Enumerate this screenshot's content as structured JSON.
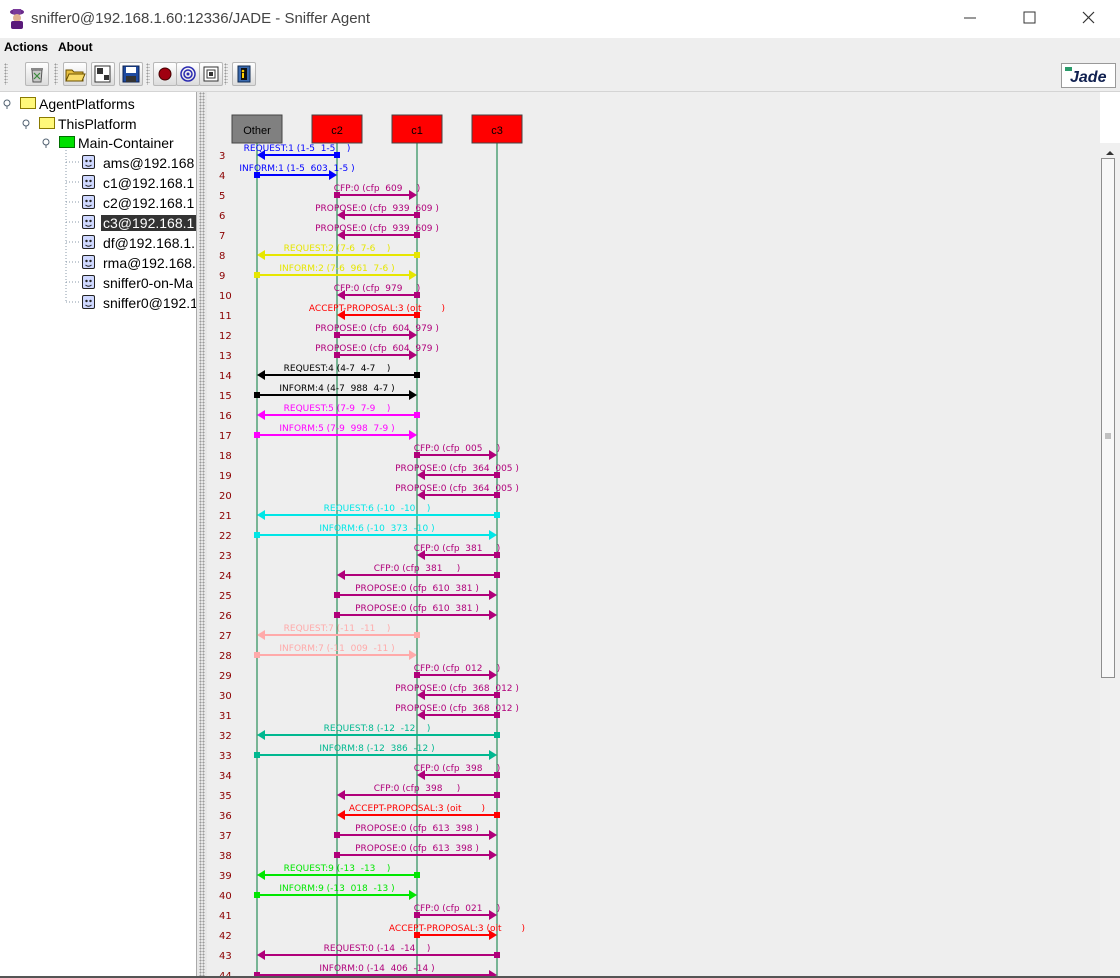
{
  "window": {
    "title": "sniffer0@192.168.1.60:12336/JADE - Sniffer Agent"
  },
  "menu": {
    "actions": "Actions",
    "about": "About"
  },
  "toolbar": {
    "buttons": [
      "clear-canvas-icon",
      "open-icon",
      "save-file-icon",
      "save-icon",
      "record-icon",
      "snif-icon",
      "filter-icon",
      "exit-icon"
    ]
  },
  "logo": {
    "text": "Jade"
  },
  "tree": {
    "root": "AgentPlatforms",
    "platform": "ThisPlatform",
    "container": "Main-Container",
    "agents": [
      {
        "label": "ams@192.168",
        "selected": false
      },
      {
        "label": "c1@192.168.1",
        "selected": false
      },
      {
        "label": "c2@192.168.1",
        "selected": false
      },
      {
        "label": "c3@192.168.1",
        "selected": true
      },
      {
        "label": "df@192.168.1.",
        "selected": false
      },
      {
        "label": "rma@192.168.",
        "selected": false
      },
      {
        "label": "sniffer0-on-Ma",
        "selected": false
      },
      {
        "label": "sniffer0@192.1",
        "selected": false
      }
    ]
  },
  "sniffer": {
    "agents": [
      {
        "name": "Other",
        "color": "#808080"
      },
      {
        "name": "c2",
        "color": "#ff0000"
      },
      {
        "name": "c1",
        "color": "#ff0000"
      },
      {
        "name": "c3",
        "color": "#ff0000"
      }
    ],
    "messages": [
      {
        "n": "3",
        "label": "REQUEST:1 (1-5  1-5    )",
        "from": "c2",
        "to": "Other",
        "color": "#0000ff"
      },
      {
        "n": "4",
        "label": "INFORM:1 (1-5  603  1-5 )",
        "from": "Other",
        "to": "c2",
        "color": "#0000ff"
      },
      {
        "n": "5",
        "label": "CFP:0 (cfp  609     )",
        "from": "c2",
        "to": "c1",
        "color": "#b0007a"
      },
      {
        "n": "6",
        "label": "PROPOSE:0 (cfp  939  609 )",
        "from": "c1",
        "to": "c2",
        "color": "#b0007a"
      },
      {
        "n": "7",
        "label": "PROPOSE:0 (cfp  939  609 )",
        "from": "c1",
        "to": "c2",
        "color": "#b0007a"
      },
      {
        "n": "8",
        "label": "REQUEST:2 (7-6  7-6    )",
        "from": "c1",
        "to": "Other",
        "color": "#e6e600"
      },
      {
        "n": "9",
        "label": "INFORM:2 (7-6  961  7-6 )",
        "from": "Other",
        "to": "c1",
        "color": "#e6e600"
      },
      {
        "n": "10",
        "label": "CFP:0 (cfp  979     )",
        "from": "c1",
        "to": "c2",
        "color": "#b0007a"
      },
      {
        "n": "11",
        "label": "ACCEPT-PROPOSAL:3 (oit       )",
        "from": "c1",
        "to": "c2",
        "color": "#ff0000"
      },
      {
        "n": "12",
        "label": "PROPOSE:0 (cfp  604  979 )",
        "from": "c2",
        "to": "c1",
        "color": "#b0007a"
      },
      {
        "n": "13",
        "label": "PROPOSE:0 (cfp  604  979 )",
        "from": "c2",
        "to": "c1",
        "color": "#b0007a"
      },
      {
        "n": "14",
        "label": "REQUEST:4 (4-7  4-7    )",
        "from": "c1",
        "to": "Other",
        "color": "#000000"
      },
      {
        "n": "15",
        "label": "INFORM:4 (4-7  988  4-7 )",
        "from": "Other",
        "to": "c1",
        "color": "#000000"
      },
      {
        "n": "16",
        "label": "REQUEST:5 (7-9  7-9    )",
        "from": "c1",
        "to": "Other",
        "color": "#ff00ff"
      },
      {
        "n": "17",
        "label": "INFORM:5 (7-9  998  7-9 )",
        "from": "Other",
        "to": "c1",
        "color": "#ff00ff"
      },
      {
        "n": "18",
        "label": "CFP:0 (cfp  005     )",
        "from": "c1",
        "to": "c3",
        "color": "#b0007a"
      },
      {
        "n": "19",
        "label": "PROPOSE:0 (cfp  364  005 )",
        "from": "c3",
        "to": "c1",
        "color": "#b0007a"
      },
      {
        "n": "20",
        "label": "PROPOSE:0 (cfp  364  005 )",
        "from": "c3",
        "to": "c1",
        "color": "#b0007a"
      },
      {
        "n": "21",
        "label": "REQUEST:6 (-10  -10    )",
        "from": "c3",
        "to": "Other",
        "color": "#00e6e6"
      },
      {
        "n": "22",
        "label": "INFORM:6 (-10  373  -10 )",
        "from": "Other",
        "to": "c3",
        "color": "#00e6e6"
      },
      {
        "n": "23",
        "label": "CFP:0 (cfp  381     )",
        "from": "c3",
        "to": "c1",
        "color": "#b0007a"
      },
      {
        "n": "24",
        "label": "CFP:0 (cfp  381     )",
        "from": "c3",
        "to": "c2",
        "color": "#b0007a"
      },
      {
        "n": "25",
        "label": "PROPOSE:0 (cfp  610  381 )",
        "from": "c2",
        "to": "c3",
        "color": "#b0007a"
      },
      {
        "n": "26",
        "label": "PROPOSE:0 (cfp  610  381 )",
        "from": "c2",
        "to": "c3",
        "color": "#b0007a"
      },
      {
        "n": "27",
        "label": "REQUEST:7 (-11  -11    )",
        "from": "c1",
        "to": "Other",
        "color": "#ffaaaa"
      },
      {
        "n": "28",
        "label": "INFORM:7 (-11  009  -11 )",
        "from": "Other",
        "to": "c1",
        "color": "#ffaaaa"
      },
      {
        "n": "29",
        "label": "CFP:0 (cfp  012     )",
        "from": "c1",
        "to": "c3",
        "color": "#b0007a"
      },
      {
        "n": "30",
        "label": "PROPOSE:0 (cfp  368  012 )",
        "from": "c3",
        "to": "c1",
        "color": "#b0007a"
      },
      {
        "n": "31",
        "label": "PROPOSE:0 (cfp  368  012 )",
        "from": "c3",
        "to": "c1",
        "color": "#b0007a"
      },
      {
        "n": "32",
        "label": "REQUEST:8 (-12  -12    )",
        "from": "c3",
        "to": "Other",
        "color": "#00b890"
      },
      {
        "n": "33",
        "label": "INFORM:8 (-12  386  -12 )",
        "from": "Other",
        "to": "c3",
        "color": "#00b890"
      },
      {
        "n": "34",
        "label": "CFP:0 (cfp  398     )",
        "from": "c3",
        "to": "c1",
        "color": "#b0007a"
      },
      {
        "n": "35",
        "label": "CFP:0 (cfp  398     )",
        "from": "c3",
        "to": "c2",
        "color": "#b0007a"
      },
      {
        "n": "36",
        "label": "ACCEPT-PROPOSAL:3 (oit       )",
        "from": "c3",
        "to": "c2",
        "color": "#ff0000"
      },
      {
        "n": "37",
        "label": "PROPOSE:0 (cfp  613  398 )",
        "from": "c2",
        "to": "c3",
        "color": "#b0007a"
      },
      {
        "n": "38",
        "label": "PROPOSE:0 (cfp  613  398 )",
        "from": "c2",
        "to": "c3",
        "color": "#b0007a"
      },
      {
        "n": "39",
        "label": "REQUEST:9 (-13  -13    )",
        "from": "c1",
        "to": "Other",
        "color": "#00e600"
      },
      {
        "n": "40",
        "label": "INFORM:9 (-13  018  -13 )",
        "from": "Other",
        "to": "c1",
        "color": "#00e600"
      },
      {
        "n": "41",
        "label": "CFP:0 (cfp  021     )",
        "from": "c1",
        "to": "c3",
        "color": "#b0007a"
      },
      {
        "n": "42",
        "label": "ACCEPT-PROPOSAL:3 (oit       )",
        "from": "c1",
        "to": "c3",
        "color": "#ff0000"
      },
      {
        "n": "43",
        "label": "REQUEST:0 (-14  -14    )",
        "from": "c3",
        "to": "Other",
        "color": "#b0007a"
      },
      {
        "n": "44",
        "label": "INFORM:0 (-14  406  -14 )",
        "from": "Other",
        "to": "c3",
        "color": "#b0007a"
      }
    ]
  }
}
